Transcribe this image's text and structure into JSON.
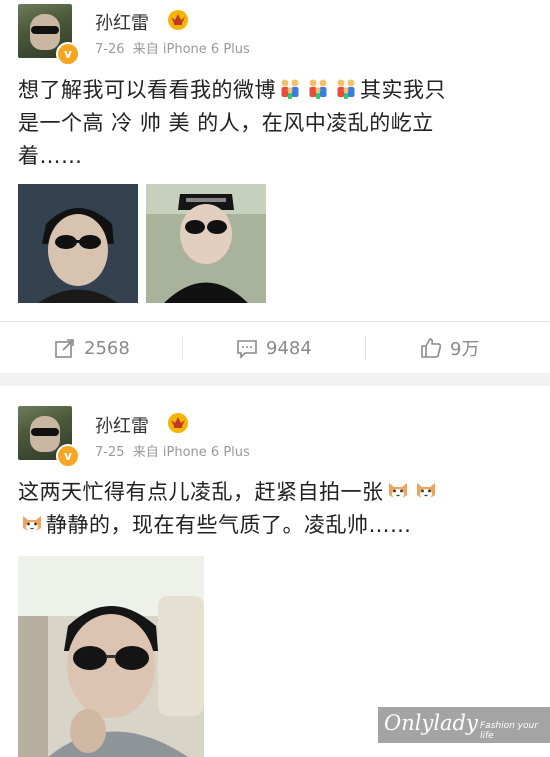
{
  "posts": [
    {
      "author": "孙红雷",
      "time": "7-26",
      "source": "来自 iPhone 6 Plus",
      "text_line1": "想了解我可以看看我的微博",
      "text_line1b": "其实我只",
      "text_line2": "是一个高 冷 帅 美 的人，在风中凌乱的屹立",
      "text_line3": "着……",
      "emoji_family": "family-emoji",
      "repost_count": "2568",
      "comment_count": "9484",
      "like_count": "9万"
    },
    {
      "author": "孙红雷",
      "time": "7-25",
      "source": "来自 iPhone 6 Plus",
      "text_line1": "这两天忙得有点儿凌乱，赶紧自拍一张",
      "text_line2": "静静的，现在有些气质了。凌乱帅……",
      "emoji_cat": "cat-emoji"
    }
  ],
  "watermark": {
    "brand": "Onlylady",
    "tagline": "Fashion your life"
  },
  "colors": {
    "verified": "#f6a623",
    "crown": "#f6b400",
    "meta": "#999999",
    "icon": "#8a8a8a"
  }
}
